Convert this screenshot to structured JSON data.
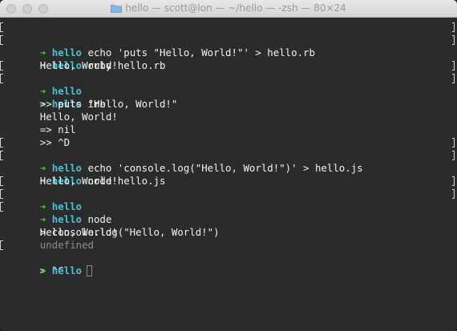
{
  "window": {
    "title": "hello — scott@lon — ~/hello — -zsh — 80×24"
  },
  "colors": {
    "prompt_arrow": "#4ec040",
    "prompt_dir": "#46c2d6",
    "text": "#f2f2f2",
    "dim": "#8c8c8c",
    "background": "#2b2b2b"
  },
  "prompt": {
    "arrow": "➜",
    "dir": "hello"
  },
  "lines": [
    {
      "cmd": "echo 'puts \"Hello, World!\"' > hello.rb"
    },
    {
      "cmd": "ruby hello.rb"
    },
    {
      "out": "Hello, World!"
    },
    {
      "cmd": ""
    },
    {
      "cmd": "irb"
    },
    {
      "out": ">> puts \"Hello, World!\""
    },
    {
      "out": "Hello, World!"
    },
    {
      "out": "=> nil"
    },
    {
      "out": ">> ^D"
    },
    {
      "cmd": "echo 'console.log(\"Hello, World!\")' > hello.js"
    },
    {
      "cmd": "node hello.js"
    },
    {
      "out": "Hello, World!"
    },
    {
      "cmd": ""
    },
    {
      "cmd": "node"
    },
    {
      "out": "> console.log(\"Hello, World!\")"
    },
    {
      "out": "Hello, World!"
    },
    {
      "out": "undefined"
    },
    {
      "out": "> ^C"
    }
  ]
}
